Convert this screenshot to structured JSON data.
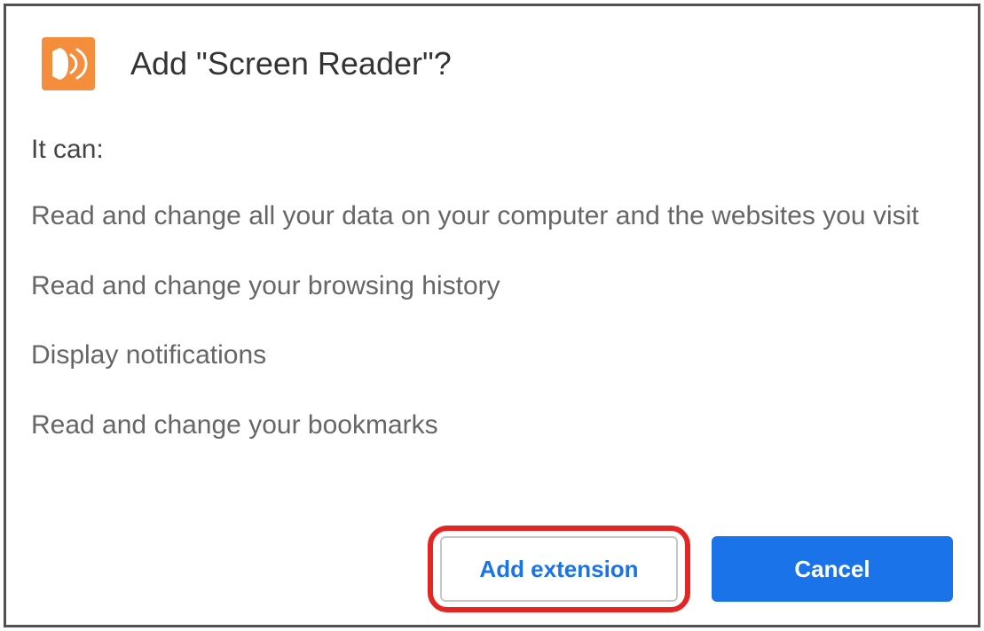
{
  "dialog": {
    "title": "Add \"Screen Reader\"?",
    "permissions_label": "It can:",
    "permissions": {
      "0": "Read and change all your data on your computer and the websites you visit",
      "1": "Read and change your browsing history",
      "2": "Display notifications",
      "3": "Read and change your bookmarks"
    },
    "buttons": {
      "add": "Add extension",
      "cancel": "Cancel"
    },
    "icon": {
      "name": "screen-reader-icon",
      "bg_color": "#f58e3c"
    }
  }
}
